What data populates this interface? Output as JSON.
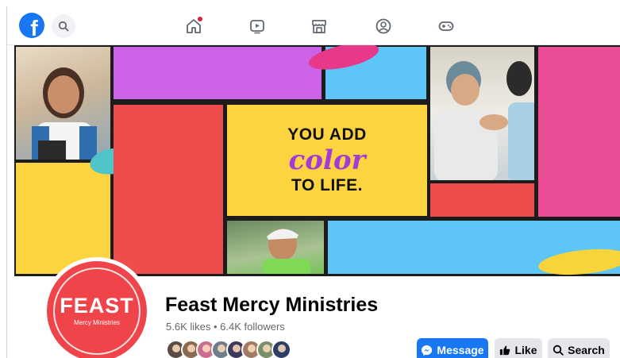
{
  "nav": {
    "logo_letter": "f",
    "icons": [
      "home-icon",
      "watch-icon",
      "marketplace-icon",
      "groups-icon",
      "gaming-icon"
    ]
  },
  "cover": {
    "tagline_line1": "YOU ADD",
    "tagline_line2": "color",
    "tagline_line3": "TO LIFE.",
    "colors": {
      "yellow": "#fcd440",
      "magenta": "#cc62e8",
      "sky": "#5ec6f7",
      "red": "#ee4d4d",
      "pink": "#ea4d96"
    }
  },
  "profile": {
    "logo_text": "FEAST",
    "logo_subtext": "Mercy Ministries",
    "page_name": "Feast Mercy Ministries",
    "stats": "5.6K likes • 6.4K followers",
    "friend_avatar_count": 8
  },
  "actions": {
    "message_label": "Message",
    "like_label": "Like",
    "search_label": "Search"
  },
  "colors": {
    "brand_blue": "#1877f2",
    "logo_red": "#f0444b",
    "button_gray": "#e4e6eb"
  }
}
